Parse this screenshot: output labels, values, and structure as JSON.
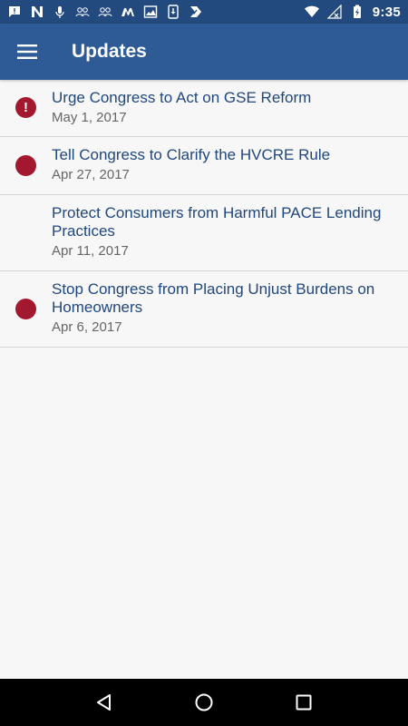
{
  "status_bar": {
    "time": "9:35",
    "left_icons": [
      "message-icon",
      "n-app-icon",
      "mic-icon",
      "people-icon",
      "people-icon-2",
      "m-app-icon",
      "image-icon",
      "download-icon",
      "check-app-icon"
    ],
    "right_icons": [
      "wifi-icon",
      "no-signal-icon",
      "battery-charging-icon"
    ]
  },
  "app_bar": {
    "title": "Updates",
    "menu_icon": "hamburger-menu-icon",
    "color": "#2e5b95"
  },
  "updates": [
    {
      "title": "Urge Congress to Act on GSE Reform",
      "date": "May 1, 2017",
      "indicator": "alert",
      "indicator_text": "!"
    },
    {
      "title": "Tell Congress to Clarify the HVCRE Rule",
      "date": "Apr 27, 2017",
      "indicator": "dot",
      "indicator_text": ""
    },
    {
      "title": "Protect Consumers from Harmful PACE Lending Practices",
      "date": "Apr 11, 2017",
      "indicator": "none",
      "indicator_text": ""
    },
    {
      "title": "Stop Congress from Placing Unjust Burdens on Homeowners",
      "date": "Apr 6, 2017",
      "indicator": "dot",
      "indicator_text": ""
    }
  ],
  "colors": {
    "indicator": "#a3182e",
    "title_text": "#20477e",
    "status_bar": "#234a7e"
  },
  "nav_bar": {
    "icons": [
      "back-icon",
      "home-icon",
      "recents-icon"
    ]
  }
}
